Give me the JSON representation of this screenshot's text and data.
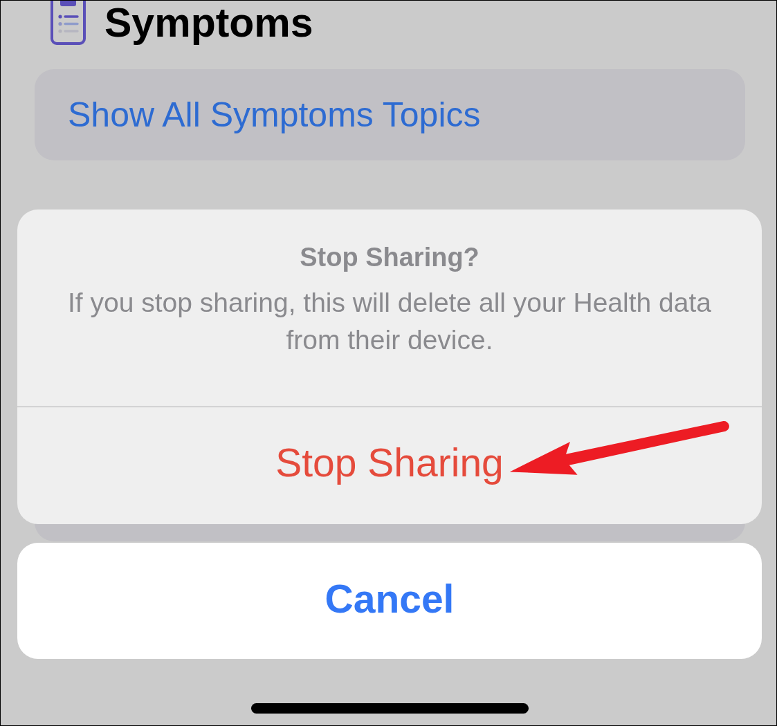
{
  "header": {
    "title": "Symptoms"
  },
  "topics_card": {
    "link": "Show All Symptoms Topics"
  },
  "alert": {
    "title": "Stop Sharing?",
    "message": "If you stop sharing, this will delete all your Health data from their device.",
    "actions": [
      {
        "label": "Stop Sharing",
        "kind": "destructive"
      }
    ]
  },
  "cancel": {
    "label": "Cancel"
  },
  "annotations": [
    {
      "kind": "arrow"
    }
  ]
}
